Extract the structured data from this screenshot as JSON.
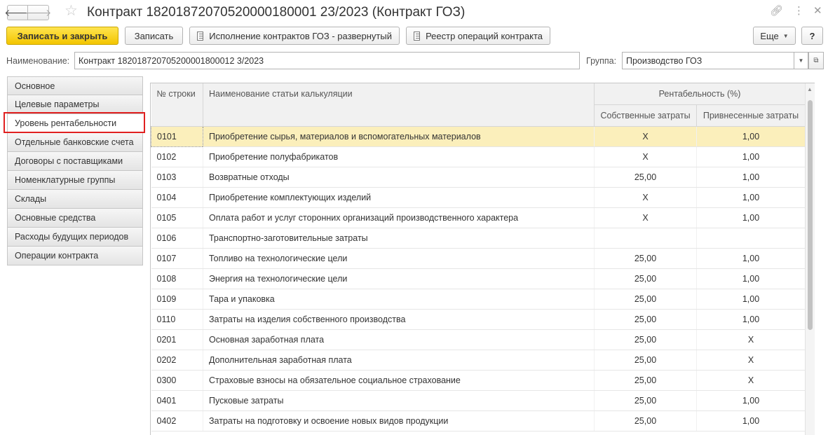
{
  "window": {
    "title": "Контракт 18201872070520000180001 23/2023 (Контракт ГОЗ)",
    "nav_back": "🡐",
    "nav_forward": "🡒",
    "icons": [
      "back-arrow-icon",
      "forward-arrow-icon",
      "star-icon",
      "link-icon",
      "menu-icon",
      "close-icon"
    ]
  },
  "toolbar": {
    "save_close": "Записать и закрыть",
    "save": "Записать",
    "report1": "Исполнение контрактов ГОЗ - развернутый",
    "report2": "Реестр операций контракта",
    "more": "Еще",
    "help": "?"
  },
  "fields": {
    "name_label": "Наименование:",
    "name_value": "Контракт 182018720705200001800012 3/2023",
    "group_label": "Группа:",
    "group_value": "Производство ГОЗ"
  },
  "sidebar": {
    "items": [
      "Основное",
      "Целевые параметры",
      "Уровень рентабельности",
      "Отдельные банковские счета",
      "Договоры с поставщиками",
      "Номенклатурные группы",
      "Склады",
      "Основные средства",
      "Расходы будущих периодов",
      "Операции контракта"
    ],
    "active_index": 2
  },
  "table": {
    "col_row_no": "№ строки",
    "col_name": "Наименование статьи калькуляции",
    "col_group": "Рентабельность (%)",
    "col_own": "Собственные затраты",
    "col_brought": "Привнесенные затраты",
    "rows": [
      [
        "0101",
        "Приобретение сырья, материалов и вспомогательных материалов",
        "X",
        "1,00"
      ],
      [
        "0102",
        "Приобретение полуфабрикатов",
        "X",
        "1,00"
      ],
      [
        "0103",
        "Возвратные отходы",
        "25,00",
        "1,00"
      ],
      [
        "0104",
        "Приобретение комплектующих изделий",
        "X",
        "1,00"
      ],
      [
        "0105",
        "Оплата работ и услуг сторонних организаций производственного характера",
        "X",
        "1,00"
      ],
      [
        "0106",
        "Транспортно-заготовительные затраты",
        "",
        ""
      ],
      [
        "0107",
        "Топливо на технологические цели",
        "25,00",
        "1,00"
      ],
      [
        "0108",
        "Энергия на технологические цели",
        "25,00",
        "1,00"
      ],
      [
        "0109",
        "Тара и упаковка",
        "25,00",
        "1,00"
      ],
      [
        "0110",
        "Затраты на изделия собственного производства",
        "25,00",
        "1,00"
      ],
      [
        "0201",
        "Основная заработная плата",
        "25,00",
        "X"
      ],
      [
        "0202",
        "Дополнительная заработная плата",
        "25,00",
        "X"
      ],
      [
        "0300",
        "Страховые взносы на обязательное социальное страхование",
        "25,00",
        "X"
      ],
      [
        "0401",
        "Пусковые затраты",
        "25,00",
        "1,00"
      ],
      [
        "0402",
        "Затраты на подготовку и освоение новых видов продукции",
        "25,00",
        "1,00"
      ]
    ],
    "selected_index": 0
  },
  "colors": {
    "primary_button": "#f3c500",
    "selected_row": "#fbefbb",
    "highlight": "#e02020"
  }
}
